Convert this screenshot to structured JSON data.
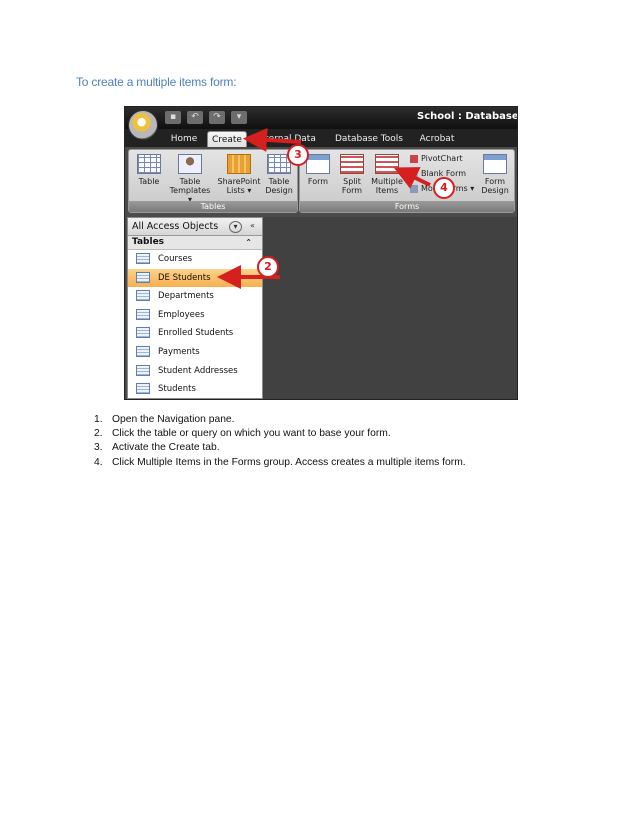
{
  "heading": "To create a multiple items form:",
  "screenshot": {
    "window_title": "School : Database (Acce",
    "tabs": [
      "Home",
      "Create",
      "External Data",
      "Database Tools",
      "Acrobat"
    ],
    "ribbon": {
      "tables_group": {
        "label": "Tables",
        "buttons": [
          {
            "line1": "Table",
            "line2": ""
          },
          {
            "line1": "Table",
            "line2": "Templates ▾"
          },
          {
            "line1": "SharePoint",
            "line2": "Lists ▾"
          },
          {
            "line1": "Table",
            "line2": "Design"
          }
        ]
      },
      "forms_group": {
        "label": "Forms",
        "buttons": [
          {
            "line1": "Form",
            "line2": ""
          },
          {
            "line1": "Split",
            "line2": "Form"
          },
          {
            "line1": "Multiple",
            "line2": "Items"
          },
          {
            "line1": "Form",
            "line2": "Design"
          }
        ],
        "small_buttons": [
          "PivotChart",
          "Blank Form",
          "More Forms ▾"
        ]
      }
    },
    "nav_pane": {
      "title": "All Access Objects",
      "group": "Tables",
      "items": [
        "Courses",
        "DE Students",
        "Departments",
        "Employees",
        "Enrolled Students",
        "Payments",
        "Student Addresses",
        "Students"
      ],
      "selected": "DE Students"
    },
    "callouts": [
      "2",
      "3",
      "4"
    ]
  },
  "steps": [
    {
      "num": "1.",
      "text": "Open the Navigation pane."
    },
    {
      "num": "2.",
      "text": "Click the table or query on which you want to base your form."
    },
    {
      "num": "3.",
      "text": "Activate the Create tab."
    },
    {
      "num": "4.",
      "text": "Click Multiple Items in the Forms group. Access creates a multiple items form."
    }
  ],
  "colors": {
    "heading": "#4f81bd",
    "callout": "#d61f1f",
    "selected_row": "#f7b04f"
  }
}
